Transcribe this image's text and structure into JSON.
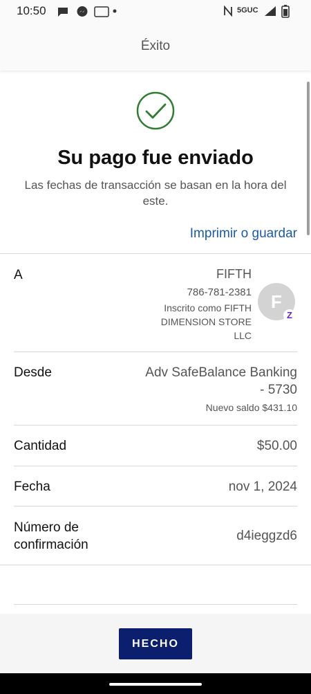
{
  "status_bar": {
    "time": "10:50",
    "network": "5GUC"
  },
  "app_bar": {
    "title": "Éxito"
  },
  "confirmation": {
    "icon": "check-circle-icon",
    "accent_color": "#2e7d32",
    "headline": "Su pago fue enviado",
    "subtext": "Las fechas de transacción se basan en la hora del este.",
    "print_link": "Imprimir o guardar"
  },
  "details": {
    "to": {
      "label": "A",
      "name": "FIFTH",
      "phone": "786-781-2381",
      "enrolled": "Inscrito como FIFTH DIMENSION STORE LLC",
      "avatar_letter": "F",
      "badge_letter": "Z"
    },
    "from": {
      "label": "Desde",
      "account": "Adv SafeBalance Banking - 5730",
      "new_balance": "Nuevo saldo $431.10"
    },
    "amount": {
      "label": "Cantidad",
      "value": "$50.00"
    },
    "date": {
      "label": "Fecha",
      "value": "nov 1, 2024"
    },
    "confirmation_number": {
      "label": "Número de confirmación",
      "value": "d4ieggzd6"
    }
  },
  "footer": {
    "done_label": "HECHO",
    "button_color": "#0b1f6e"
  }
}
